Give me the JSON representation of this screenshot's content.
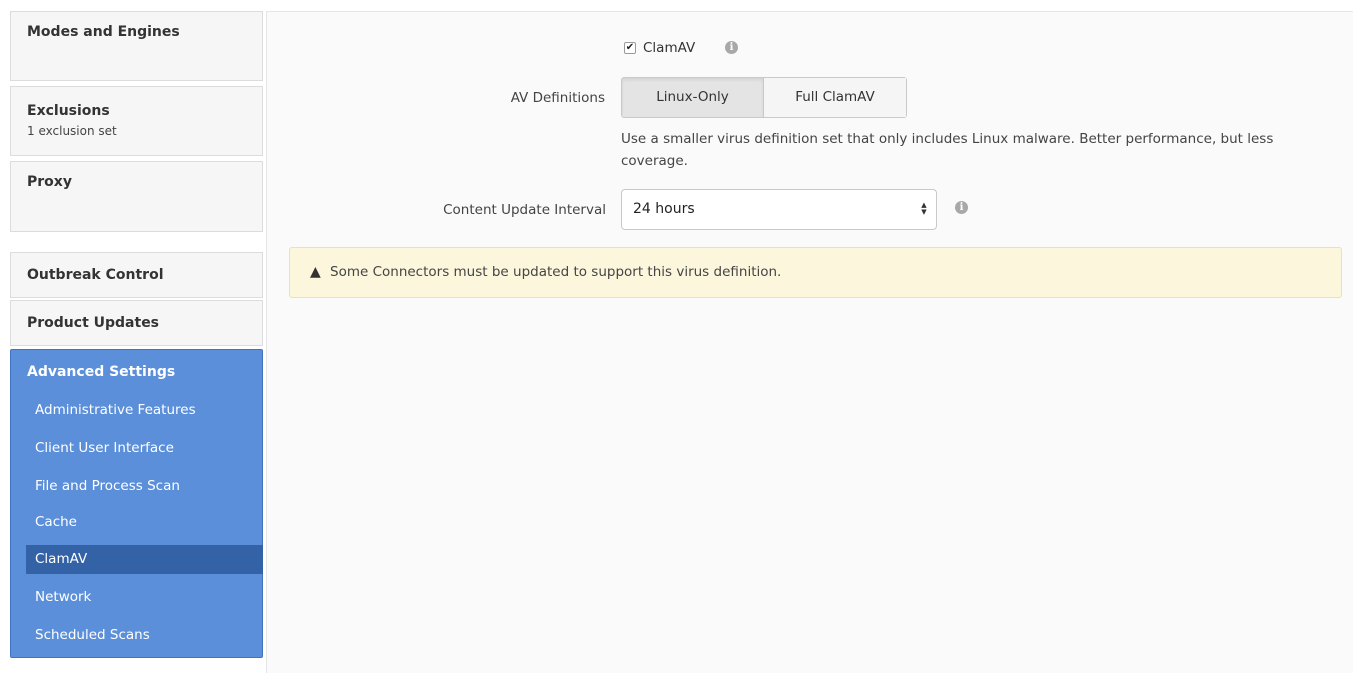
{
  "sidebar": {
    "cards": [
      {
        "title": "Modes and Engines",
        "sub": ""
      },
      {
        "title": "Exclusions",
        "sub": "1 exclusion set"
      },
      {
        "title": "Proxy",
        "sub": ""
      },
      {
        "title": "Outbreak Control",
        "sub": ""
      },
      {
        "title": "Product Updates",
        "sub": ""
      }
    ],
    "advanced": {
      "title": "Advanced Settings",
      "items": [
        "Administrative Features",
        "Client User Interface",
        "File and Process Scan",
        "Cache",
        "ClamAV",
        "Network",
        "Scheduled Scans"
      ],
      "active_item": "ClamAV"
    }
  },
  "main": {
    "clamav_checkbox_label": "ClamAV",
    "clamav_checked": true,
    "av_definitions_label": "AV Definitions",
    "av_options": [
      "Linux-Only",
      "Full ClamAV"
    ],
    "av_selected": "Linux-Only",
    "av_description": "Use a smaller virus definition set that only includes Linux malware. Better performance, but less coverage.",
    "content_update_label": "Content Update Interval",
    "content_update_value": "24 hours",
    "alert_text": "Some Connectors must be updated to support this virus definition."
  },
  "icons": {
    "info": "info-icon",
    "warning": "warning-icon",
    "check": "check-icon",
    "select_arrows": "select-arrows-icon"
  },
  "colors": {
    "sidebar_active_bg": "#5b8fd9",
    "sidebar_selected_item_bg": "#3462a6",
    "alert_bg": "#fcf7dc"
  }
}
